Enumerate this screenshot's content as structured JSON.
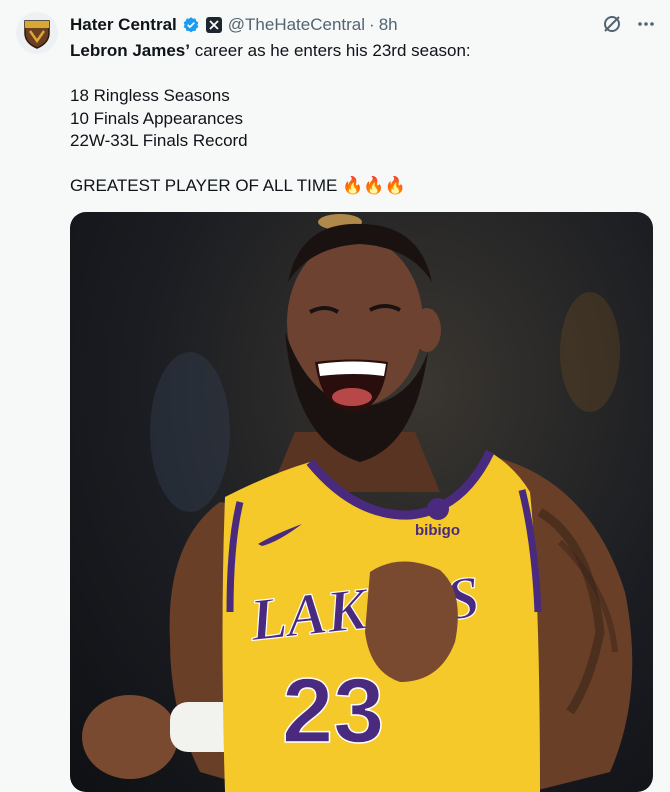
{
  "tweet": {
    "display_name": "Hater Central",
    "handle": "@TheHateCentral",
    "separator": "·",
    "time": "8h",
    "text_bold": "Lebron James’",
    "text_line1_rest": " career as he enters his 23rd season:",
    "line2": "18 Ringless Seasons",
    "line3": "10 Finals Appearances",
    "line4": "22W-33L Finals Record",
    "line5": "GREATEST PLAYER OF ALL TIME",
    "emojis": "🔥🔥🔥"
  },
  "icons": {
    "avatar": "shield-logo-icon",
    "verified": "verified-badge-icon",
    "affiliate": "x-affiliate-icon",
    "grok": "grok-icon",
    "more": "more-icon"
  },
  "photo": {
    "jersey_team": "LAKERS",
    "jersey_number": "23",
    "sponsor": "bibigo"
  },
  "colors": {
    "verified": "#1d9bf0",
    "jersey_gold": "#f5c92a",
    "jersey_purple": "#4a2a7e",
    "muted_text": "#536471"
  }
}
